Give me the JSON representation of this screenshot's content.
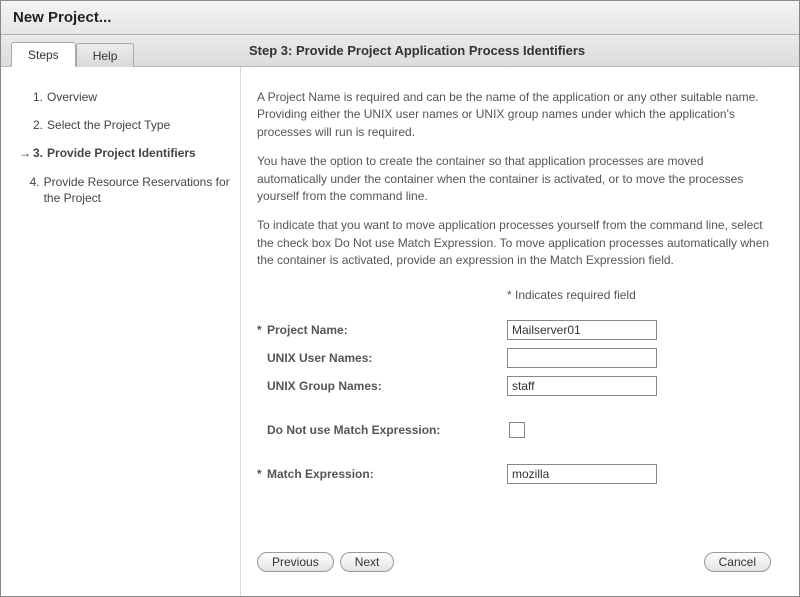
{
  "window": {
    "title": "New Project..."
  },
  "tabs": {
    "steps": "Steps",
    "help": "Help"
  },
  "step_title": "Step 3:   Provide Project Application Process Identifiers",
  "sidebar": {
    "items": [
      {
        "num": "1.",
        "label": "Overview"
      },
      {
        "num": "2.",
        "label": "Select the Project Type"
      },
      {
        "num": "3.",
        "label": "Provide Project Identifiers"
      },
      {
        "num": "4.",
        "label": "Provide Resource Reservations for the Project"
      }
    ]
  },
  "instructions": {
    "p1": "A Project Name is required and can be the name of the application or any other suitable name. Providing either the UNIX user names or UNIX group names under which the application's processes will run is required.",
    "p2": "You have the option to create the container so that application processes are moved automatically under the container when the container is activated, or to move the processes yourself from the command line.",
    "p3": "To indicate that you want to move application processes yourself from the command line, select the check box Do Not use Match Expression. To move application processes automatically when the container is activated, provide an expression in the Match Expression field."
  },
  "required_note": "Indicates required field",
  "form": {
    "project_name": {
      "label": "Project Name:",
      "value": "Mailserver01",
      "required": true
    },
    "unix_user": {
      "label": "UNIX User Names:",
      "value": "",
      "required": false
    },
    "unix_group": {
      "label": "UNIX Group Names:",
      "value": "staff",
      "required": false
    },
    "no_match": {
      "label": "Do Not use Match Expression:",
      "checked": false
    },
    "match_expr": {
      "label": "Match Expression:",
      "value": "mozilla",
      "required": true
    }
  },
  "buttons": {
    "previous": "Previous",
    "next": "Next",
    "cancel": "Cancel"
  }
}
